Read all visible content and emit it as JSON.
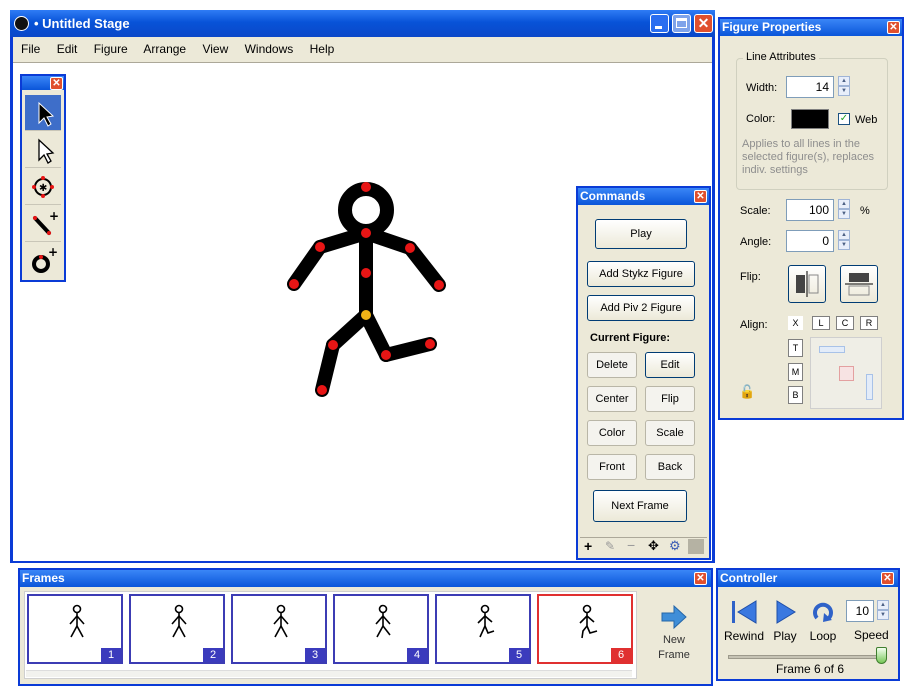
{
  "main_window": {
    "title": "• Untitled Stage",
    "menu": [
      "File",
      "Edit",
      "Figure",
      "Arrange",
      "View",
      "Windows",
      "Help"
    ]
  },
  "tools": [
    {
      "name": "select-arrow-icon",
      "selected": true
    },
    {
      "name": "direct-select-icon",
      "selected": false
    },
    {
      "name": "add-circle-point-icon",
      "selected": false
    },
    {
      "name": "add-line-icon",
      "selected": false
    },
    {
      "name": "add-circle-icon",
      "selected": false
    }
  ],
  "commands": {
    "title": "Commands",
    "play": "Play",
    "add_stykz": "Add Stykz Figure",
    "add_piv": "Add Piv 2 Figure",
    "current_figure": "Current Figure:",
    "delete": "Delete",
    "edit": "Edit",
    "center": "Center",
    "flip": "Flip",
    "color": "Color",
    "scale": "Scale",
    "front": "Front",
    "back": "Back",
    "next_frame": "Next Frame"
  },
  "properties": {
    "title": "Figure Properties",
    "line_attributes": "Line Attributes",
    "width_label": "Width:",
    "width_value": "14",
    "color_label": "Color:",
    "color_value": "#000000",
    "web_label": "Web",
    "web_checked": true,
    "applies_text": "Applies to all lines in the selected figure(s), replaces indiv. settings",
    "scale_label": "Scale:",
    "scale_value": "100",
    "scale_unit": "%",
    "angle_label": "Angle:",
    "angle_value": "0",
    "flip_label": "Flip:",
    "align_label": "Align:",
    "align_top_row": [
      "X",
      "L",
      "C",
      "R"
    ],
    "align_side_col": [
      "T",
      "M",
      "B"
    ]
  },
  "frames": {
    "title": "Frames",
    "items": [
      {
        "number": "1",
        "active": false
      },
      {
        "number": "2",
        "active": false
      },
      {
        "number": "3",
        "active": false
      },
      {
        "number": "4",
        "active": false
      },
      {
        "number": "5",
        "active": false
      },
      {
        "number": "6",
        "active": true
      }
    ],
    "new_frame_label": "New\nFrame"
  },
  "controller": {
    "title": "Controller",
    "rewind": "Rewind",
    "play": "Play",
    "loop": "Loop",
    "speed_value": "10",
    "speed_label": "Speed",
    "frame_status": "Frame 6 of 6",
    "progress": 1.0
  },
  "colors": {
    "titlebar_blue": "#0a55d9",
    "joint_red": "#e81515",
    "joint_origin": "#f2b417",
    "active_frame": "#e03030",
    "frame_badge": "#3b3bbd"
  }
}
